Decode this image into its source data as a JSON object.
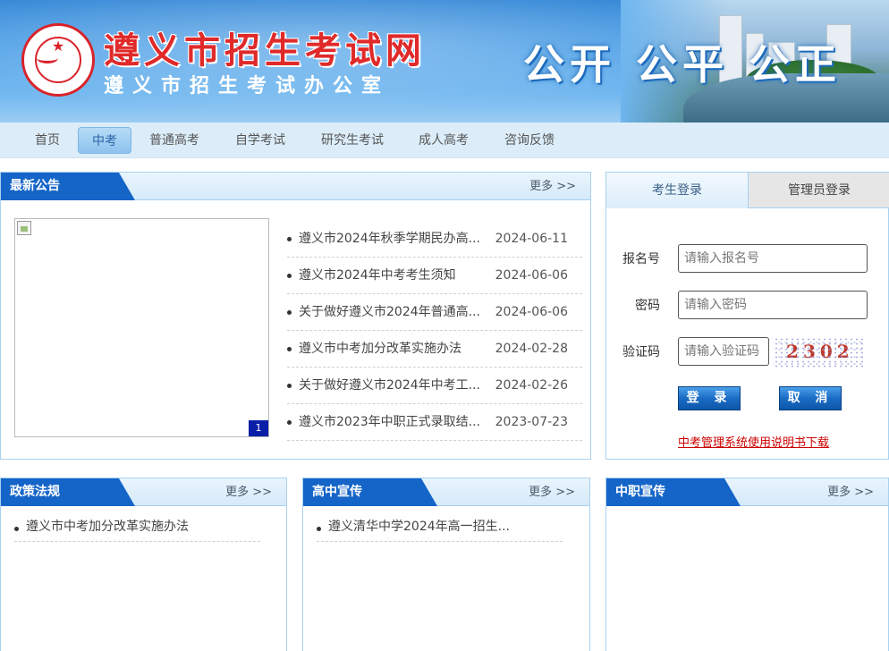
{
  "header": {
    "site_title": "遵义市招生考试网",
    "site_subtitle": "遵义市招生考试办公室",
    "slogan": "公开 公平 公正"
  },
  "nav": {
    "items": [
      {
        "label": "首页"
      },
      {
        "label": "中考",
        "active": true
      },
      {
        "label": "普通高考"
      },
      {
        "label": "自学考试"
      },
      {
        "label": "研究生考试"
      },
      {
        "label": "成人高考"
      },
      {
        "label": "咨询反馈"
      }
    ]
  },
  "announcements": {
    "title": "最新公告",
    "more": "更多 >>",
    "slide_number": "1",
    "items": [
      {
        "title": "遵义市2024年秋季学期民办高...",
        "date": "2024-06-11"
      },
      {
        "title": "遵义市2024年中考考生须知",
        "date": "2024-06-06"
      },
      {
        "title": "关于做好遵义市2024年普通高...",
        "date": "2024-06-06"
      },
      {
        "title": "遵义市中考加分改革实施办法",
        "date": "2024-02-28"
      },
      {
        "title": "关于做好遵义市2024年中考工...",
        "date": "2024-02-26"
      },
      {
        "title": "遵义市2023年中职正式录取结...",
        "date": "2023-07-23"
      }
    ]
  },
  "login": {
    "tab_student": "考生登录",
    "tab_admin": "管理员登录",
    "reg_label": "报名号",
    "reg_placeholder": "请输入报名号",
    "pwd_label": "密码",
    "pwd_placeholder": "请输入密码",
    "captcha_label": "验证码",
    "captcha_placeholder": "请输入验证码",
    "captcha_text": "2302",
    "login_button": "登 录",
    "cancel_button": "取 消",
    "manual_link": "中考管理系统使用说明书下载"
  },
  "policy": {
    "title": "政策法规",
    "more": "更多 >>",
    "items": [
      {
        "title": "遵义市中考加分改革实施办法"
      }
    ]
  },
  "highschool": {
    "title": "高中宣传",
    "more": "更多 >>",
    "items": [
      {
        "title": "遵义清华中学2024年高一招生..."
      }
    ]
  },
  "vocational": {
    "title": "中职宣传",
    "more": "更多 >>",
    "items": []
  },
  "colors": {
    "accent": "#1565c8",
    "title_red": "#e02a2a",
    "link_red": "#cc0000",
    "border": "#a9d1ef"
  }
}
